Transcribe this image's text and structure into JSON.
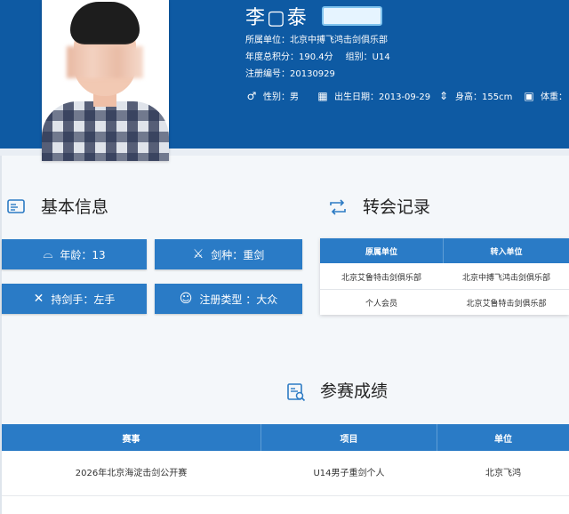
{
  "profile": {
    "name": "李▢泰",
    "affiliation": "所属单位：北京中搏飞鸿击剑俱乐部",
    "points_label": "年度总积分：190.4分",
    "group_label": "组别：U14",
    "reg_label": "注册编号：20130929",
    "gender": "性别：男",
    "birth": "出生日期：2013-09-29",
    "height": "身高：155cm",
    "weight": "体重："
  },
  "basic": {
    "title": "基本信息",
    "age": "年龄：13",
    "weapon": "剑种：重剑",
    "hand": "持剑手：左手",
    "reg_type": "注册类型 ：大众"
  },
  "transfer": {
    "title": "转会记录",
    "headers": [
      "原属单位",
      "转入单位"
    ],
    "rows": [
      [
        "北京艾鲁特击剑俱乐部",
        "北京中搏飞鸿击剑俱乐部"
      ],
      [
        "个人会员",
        "北京艾鲁特击剑俱乐部"
      ]
    ]
  },
  "results": {
    "title": "参赛成绩",
    "headers": [
      "赛事",
      "项目",
      "单位"
    ],
    "rows": [
      [
        "2026年北京海淀击剑公开赛",
        "U14男子重剑个人",
        "北京飞鸿"
      ]
    ]
  },
  "colors": {
    "header_blue": "#0e5aa3",
    "button_blue": "#2a7bc6",
    "icon_blue": "#2d7bc4"
  },
  "icons": {
    "gender": "gender-icon",
    "calendar": "calendar-icon",
    "height": "person-height-icon",
    "weight": "scale-icon",
    "basic": "id-card-icon",
    "transfer": "transfer-arrows-icon",
    "results": "results-document-icon",
    "age": "cake-icon",
    "weapon": "fencer-icon",
    "hand": "crossed-swords-icon",
    "reg_type": "user-icon"
  }
}
